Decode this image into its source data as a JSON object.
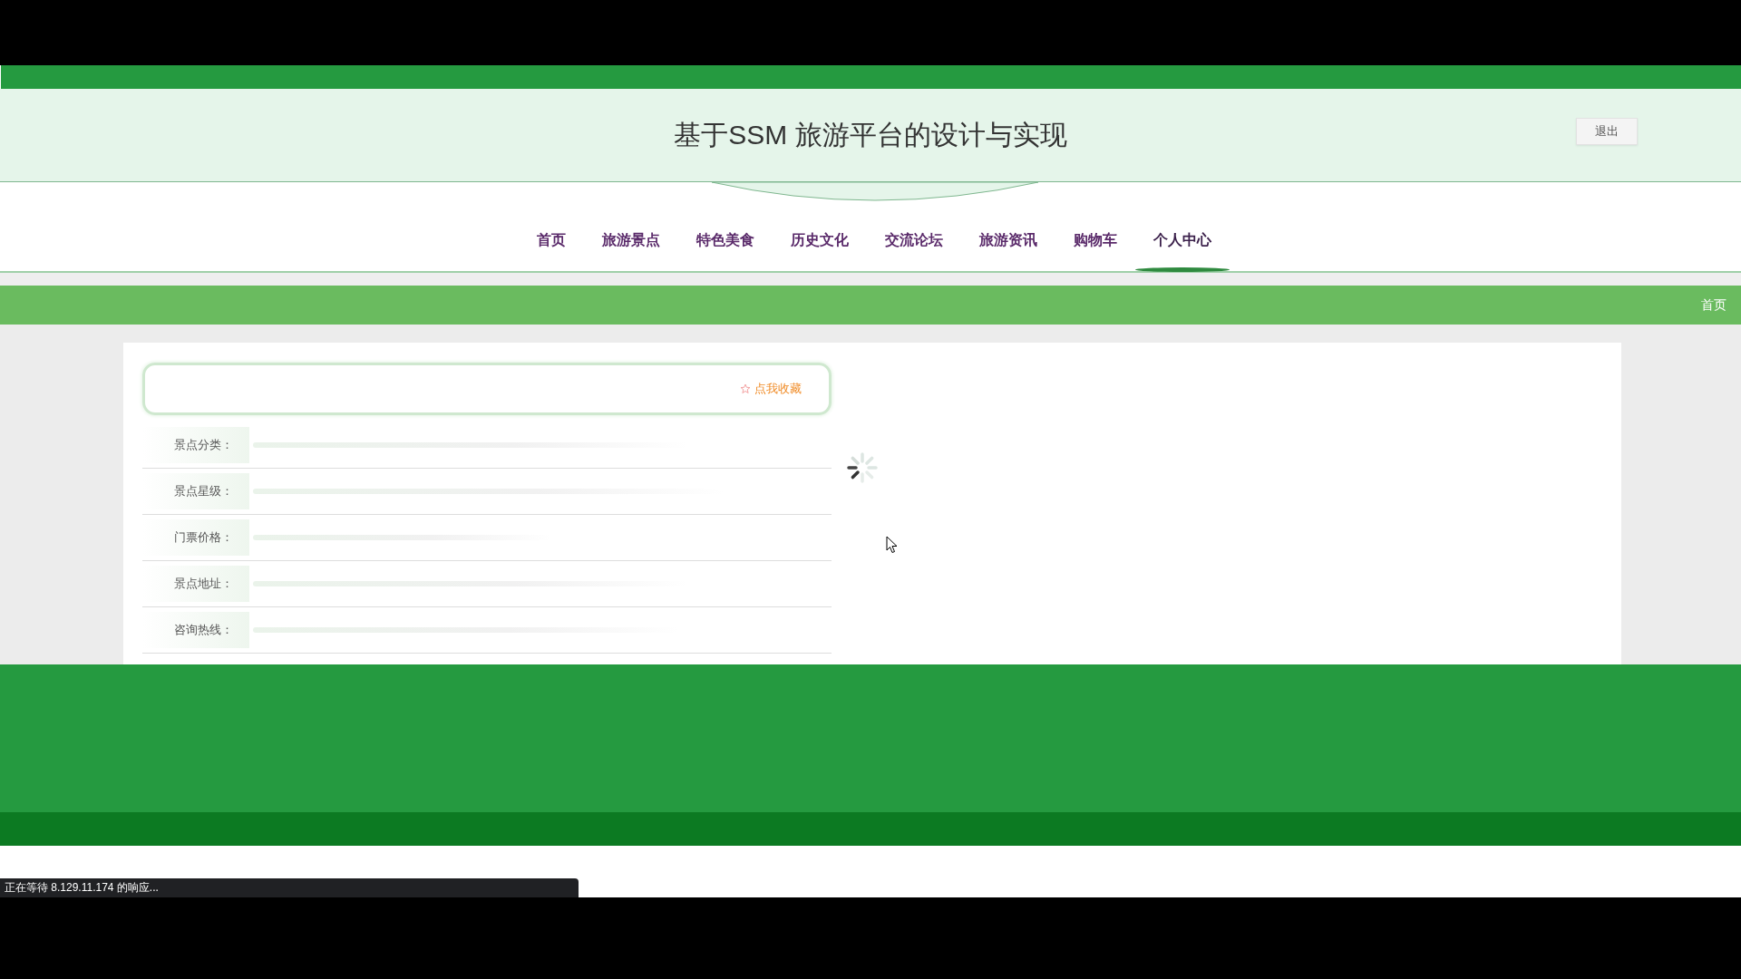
{
  "header": {
    "title": "基于SSM 旅游平台的设计与实现",
    "logout_button": "退出"
  },
  "nav": [
    {
      "label": "首页",
      "selected": false
    },
    {
      "label": "旅游景点",
      "selected": false
    },
    {
      "label": "特色美食",
      "selected": false
    },
    {
      "label": "历史文化",
      "selected": false
    },
    {
      "label": "交流论坛",
      "selected": false
    },
    {
      "label": "旅游资讯",
      "selected": false
    },
    {
      "label": "购物车",
      "selected": false
    },
    {
      "label": "个人中心",
      "selected": true
    }
  ],
  "breadcrumb": "首页",
  "detail": {
    "favorite_button": "点我收藏",
    "fields": [
      {
        "label": "景点分类："
      },
      {
        "label": "景点星级："
      },
      {
        "label": "门票价格："
      },
      {
        "label": "景点地址："
      },
      {
        "label": "咨询热线："
      }
    ]
  },
  "status_bar": "正在等待 8.129.11.174 的响应..."
}
